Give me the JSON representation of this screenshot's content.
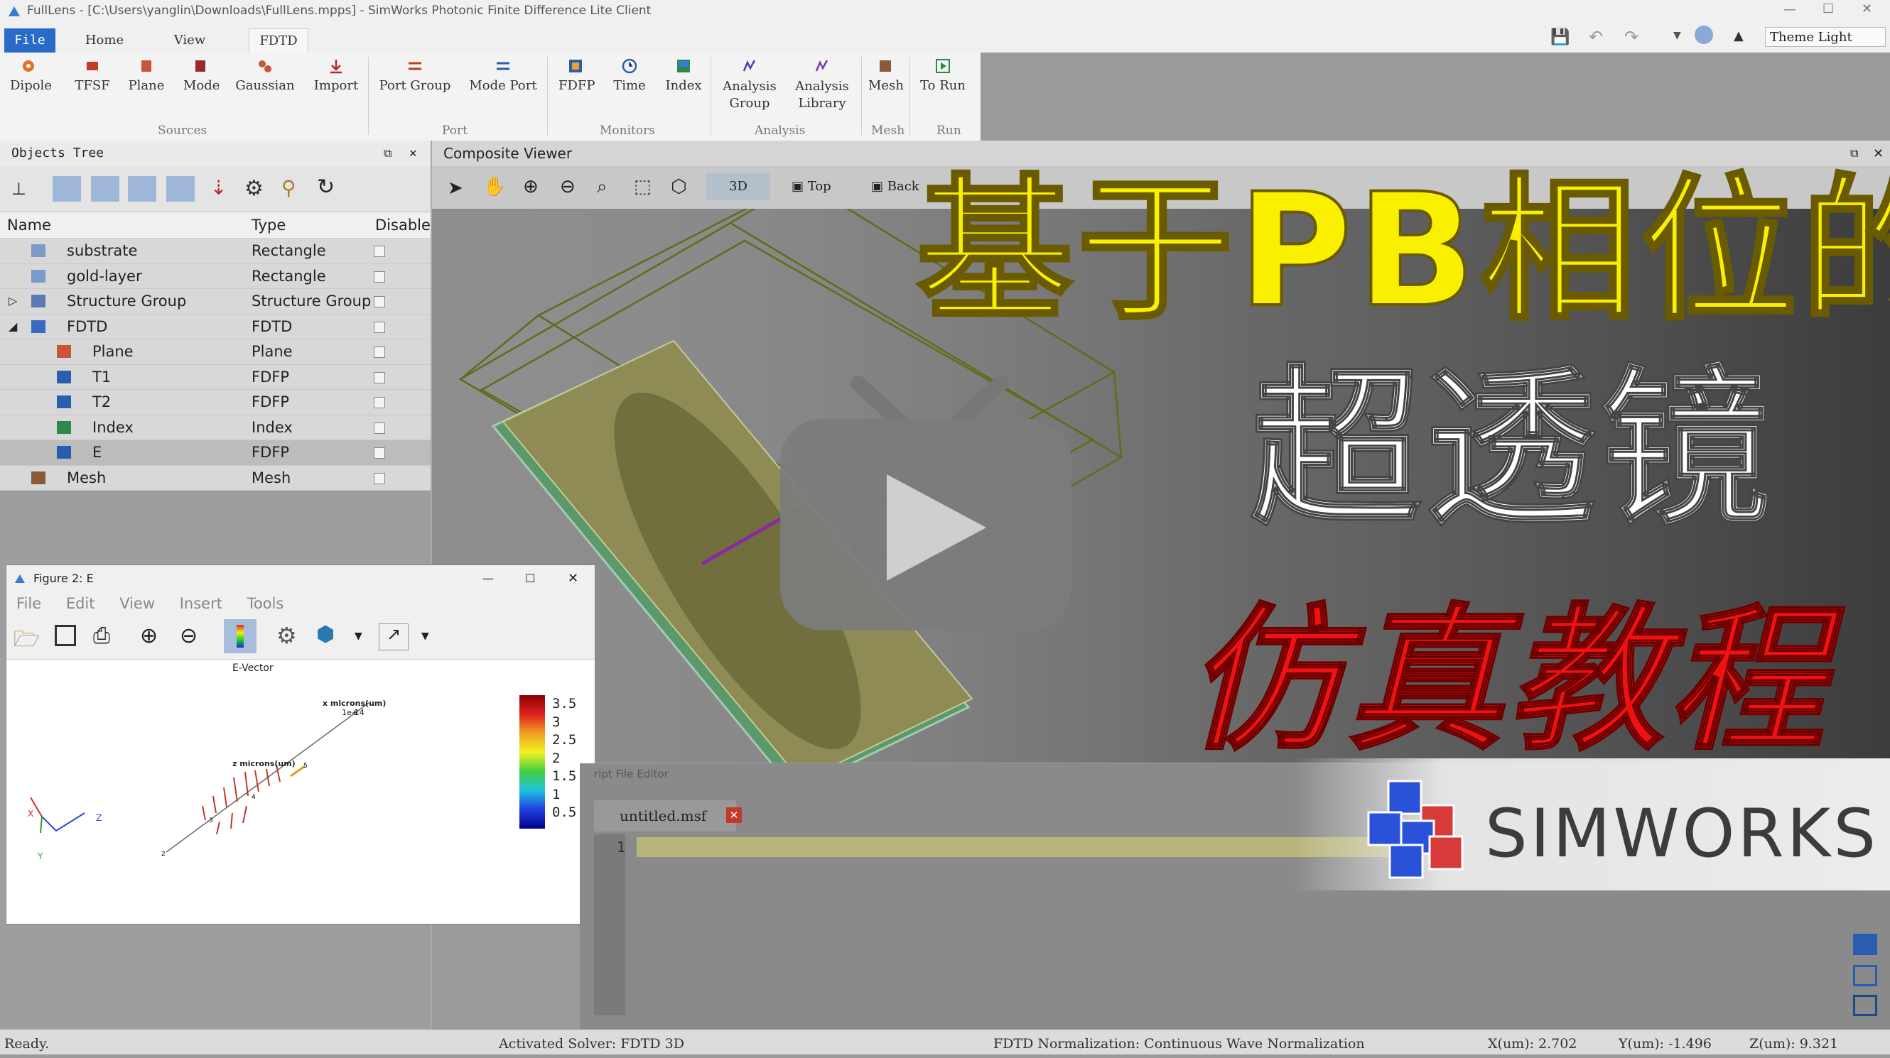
{
  "window": {
    "title": "FullLens - [C:\\Users\\yanglin\\Downloads\\FullLens.mpps] - SimWorks Photonic Finite Difference Lite Client"
  },
  "tabs": [
    {
      "label": "File"
    },
    {
      "label": "Home"
    },
    {
      "label": "View"
    },
    {
      "label": "FDTD"
    }
  ],
  "theme": {
    "label": "Theme Light"
  },
  "ribbon": {
    "buttons": [
      {
        "label": "Dipole"
      },
      {
        "label": "TFSF"
      },
      {
        "label": "Plane"
      },
      {
        "label": "Mode"
      },
      {
        "label": "Gaussian"
      },
      {
        "label": "Import"
      },
      {
        "label": "Port Group"
      },
      {
        "label": "Mode Port"
      },
      {
        "label": "FDFP"
      },
      {
        "label": "Time"
      },
      {
        "label": "Index"
      },
      {
        "label": "Analysis\nGroup"
      },
      {
        "label": "Analysis\nLibrary"
      },
      {
        "label": "Mesh"
      },
      {
        "label": "To Run"
      }
    ],
    "groups": [
      {
        "label": "Sources"
      },
      {
        "label": "Port"
      },
      {
        "label": "Monitors"
      },
      {
        "label": "Analysis"
      },
      {
        "label": "Mesh"
      },
      {
        "label": "Run"
      }
    ]
  },
  "objects_tree": {
    "title": "Objects Tree",
    "columns": {
      "name": "Name",
      "type": "Type",
      "disable": "Disable"
    },
    "rows": [
      {
        "name": "substrate",
        "type": "Rectangle"
      },
      {
        "name": "gold-layer",
        "type": "Rectangle"
      },
      {
        "name": "Structure Group",
        "type": "Structure Group"
      },
      {
        "name": "FDTD",
        "type": "FDTD"
      },
      {
        "name": "Plane",
        "type": "Plane"
      },
      {
        "name": "T1",
        "type": "FDFP"
      },
      {
        "name": "T2",
        "type": "FDFP"
      },
      {
        "name": "Index",
        "type": "Index"
      },
      {
        "name": "E",
        "type": "FDFP"
      },
      {
        "name": "Mesh",
        "type": "Mesh"
      }
    ]
  },
  "viewer": {
    "title": "Composite Viewer",
    "view_buttons": [
      {
        "label": "3D"
      },
      {
        "label": "Top"
      },
      {
        "label": "Back"
      }
    ]
  },
  "figure": {
    "title": "Figure 2: E",
    "menu": [
      {
        "label": "File"
      },
      {
        "label": "Edit"
      },
      {
        "label": "View"
      },
      {
        "label": "Insert"
      },
      {
        "label": "Tools"
      }
    ],
    "plot_title": "E-Vector",
    "axis_x_label": "x microns(um)",
    "axis_x_scale": "1e-14",
    "axis_z_label": "z microns(um)",
    "colorbar_ticks": [
      "3.5",
      "3",
      "2.5",
      "2",
      "1.5",
      "1",
      "0.5"
    ]
  },
  "editor": {
    "title": "ript File Editor",
    "file_tab": "untitled.msf",
    "line_number": "1"
  },
  "overlay": {
    "title_line1": "基于PB相位的",
    "title_line2": "超透镜",
    "title_line3": "仿真教程",
    "brand": "SIMWORKS"
  },
  "status": {
    "ready": "Ready.",
    "solver": "Activated Solver: FDTD 3D",
    "normalization": "FDTD Normalization: Continuous Wave Normalization",
    "x": "X(um): 2.702",
    "y": "Y(um): -1.496",
    "z": "Z(um): 9.321"
  }
}
